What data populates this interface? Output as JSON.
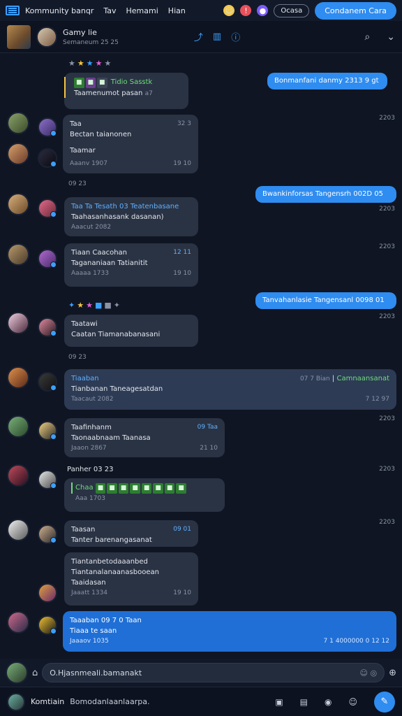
{
  "topbar": {
    "title": "Kommunity banqr",
    "nav": [
      "Tav",
      "Hemami",
      "Hian"
    ],
    "pill": "Ocasa",
    "cta": "Condanem Cara"
  },
  "header": {
    "name": "Gamy lie",
    "sub": "Semaneum 25 25"
  },
  "messages": {
    "m1": {
      "tag": "Tidio Sasstk",
      "body": "Taamenumot pasan",
      "meta": "a7"
    },
    "m2": {
      "text": "Bonmanfani danmy 2313 9 gt",
      "time": "2203"
    },
    "m3": {
      "title": "Taa",
      "t1": "Bectan taianonen",
      "t2": "Taamar",
      "foot": "Aaanv 1907",
      "meta": "19 10",
      "status": "32 3"
    },
    "sep1": "09 23",
    "m4": {
      "text": "Bwankinforsas Tangensrh 002D 05",
      "time": "2203"
    },
    "m5": {
      "title": "Taa Ta Tesath 03 Teatenbasane",
      "t1": "Taahasanhasank dasanan)",
      "foot": "Aaacut 2082"
    },
    "m6": {
      "title": "Tiaan Caacohan",
      "t1": "Tagananiaan",
      "t1b": "Tatianitit",
      "foot": "Aaaaa 1733",
      "meta": "19 10",
      "status": "12 11",
      "time": "2203"
    },
    "m7": {
      "text": "Tanvahanlasie Tangensanl 0098 01",
      "time": "2203"
    },
    "m8": {
      "title": "Taatawi",
      "t1": "Caatan Tiamanabanasani"
    },
    "sep2": "09 23",
    "m9": {
      "title": "Tiaaban",
      "t1": "Tianbanan Taneagesatdan",
      "foot": "Taacaut 2082",
      "status": "07 7 Bian",
      "tag": "Camnaansanat",
      "meta": "7 12 97"
    },
    "m10": {
      "title": "Taafinhanm",
      "t1": "Taonaabnaam",
      "t1b": "Taanasa",
      "foot": "Jaaon 2867",
      "status": "09 Taa",
      "meta": "21 10",
      "time": "2203"
    },
    "m11": {
      "label": "Panher 03 23",
      "tag": "Chaa",
      "foot": "Aaa 1703",
      "time": "2203"
    },
    "m12": {
      "title": "Taasan",
      "t1": "Tanter barenangasanat",
      "status": "09 01",
      "time": "2203"
    },
    "m13": {
      "t1": "Tiantanbetodaaanbed",
      "t2": "Tiantanalanaanasbooean",
      "t3": "Taaidasan",
      "foot": "Jaaatt 1334",
      "meta": "19 10"
    },
    "m14": {
      "title": "Taaaban 09 7 0 Taan",
      "t1": "Tiaaa te saan",
      "foot": "Jaaaov 1035",
      "meta": "7 1 4000000 0 12 12"
    }
  },
  "composer": {
    "placeholder": "O.Hjasnmeali.bamanakt"
  },
  "bottombar": {
    "name": "Komtiain",
    "status": "Bomodanlaanlaarpa."
  }
}
